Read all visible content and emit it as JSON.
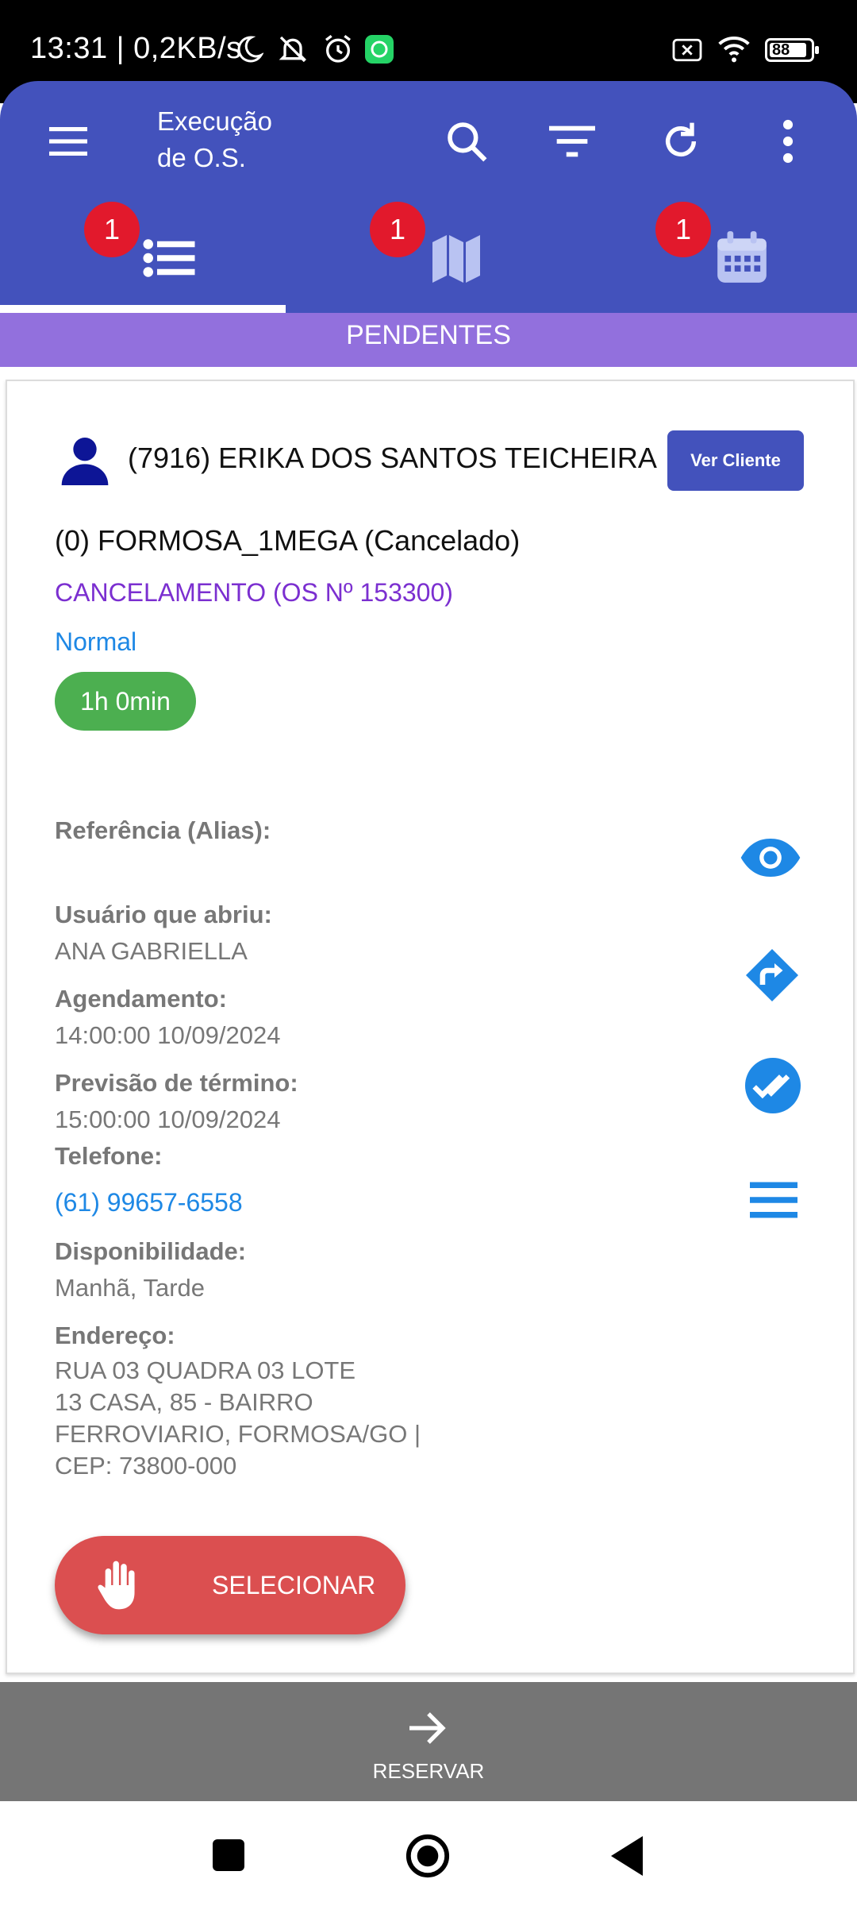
{
  "status_bar": {
    "text": "13:31 | 0,2KB/s",
    "battery": "88",
    "icons": [
      "moon-icon",
      "bell-off-icon",
      "alarm-icon",
      "whatsapp-icon",
      "sim-off-icon",
      "wifi-icon",
      "battery-icon"
    ]
  },
  "app_bar": {
    "title_line1": "Execução",
    "title_line2": "de O.S.",
    "icons": [
      "menu-icon",
      "search-icon",
      "filter-icon",
      "refresh-icon",
      "more-vert-icon"
    ]
  },
  "tabs": [
    {
      "icon": "list-icon",
      "badge": "1",
      "selected": true
    },
    {
      "icon": "map-icon",
      "badge": "1",
      "selected": false
    },
    {
      "icon": "calendar-icon",
      "badge": "1",
      "selected": false
    }
  ],
  "section_title": "PENDENTES",
  "order": {
    "client": "(7916) ERIKA DOS SANTOS TEICHEIRA",
    "ver_cliente": "Ver Cliente",
    "plan": "(0) FORMOSA_1MEGA (Cancelado)",
    "type": "CANCELAMENTO (OS Nº 153300)",
    "priority": "Normal",
    "duration": "1h 0min",
    "referencia_label": "Referência (Alias):",
    "usuario_label": "Usuário que abriu:",
    "usuario_value": "ANA GABRIELLA",
    "agendamento_label": "Agendamento:",
    "agendamento_value": "14:00:00 10/09/2024",
    "previsao_label": "Previsão de término:",
    "previsao_value": "15:00:00 10/09/2024",
    "telefone_label": "Telefone:",
    "telefone_value": "(61) 99657-6558",
    "disponibilidade_label": "Disponibilidade:",
    "disponibilidade_value": "Manhã, Tarde",
    "endereco_label": "Endereço:",
    "endereco_lines": [
      "RUA 03 QUADRA 03 LOTE",
      "13 CASA, 85 - BAIRRO",
      "FERROVIARIO, FORMOSA/GO |",
      "CEP: 73800-000"
    ],
    "select_label": "SELECIONAR",
    "side_icons": [
      "eye-icon",
      "directions-icon",
      "done-all-icon",
      "menu-lines-icon"
    ]
  },
  "footer": {
    "label": "RESERVAR"
  },
  "colors": {
    "primary": "#4352BC",
    "section": "#9270DD",
    "badge": "#E2192C",
    "select": "#DB4F50",
    "pill": "#4CAF50",
    "link": "#1E88E5",
    "purple": "#7B2FD0"
  }
}
